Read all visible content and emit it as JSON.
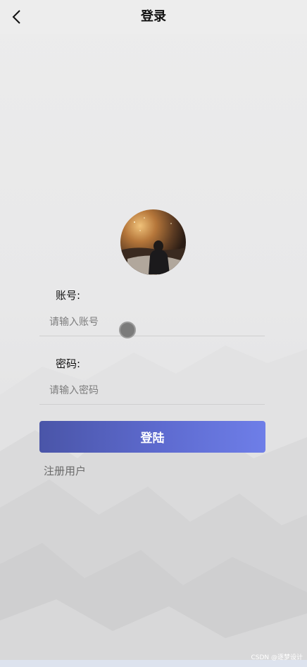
{
  "header": {
    "title": "登录"
  },
  "form": {
    "account_label": "账号:",
    "account_placeholder": "请输入账号",
    "password_label": "密码:",
    "password_placeholder": "请输入密码",
    "login_label": "登陆",
    "register_label": "注册用户"
  },
  "watermark": "CSDN @逐梦设计",
  "colors": {
    "button_gradient_start": "#4a55a8",
    "button_gradient_end": "#6e7ee8",
    "background": "#e9e9ea"
  },
  "icons": {
    "back": "chevron-left-icon",
    "avatar": "user-avatar-photo"
  }
}
